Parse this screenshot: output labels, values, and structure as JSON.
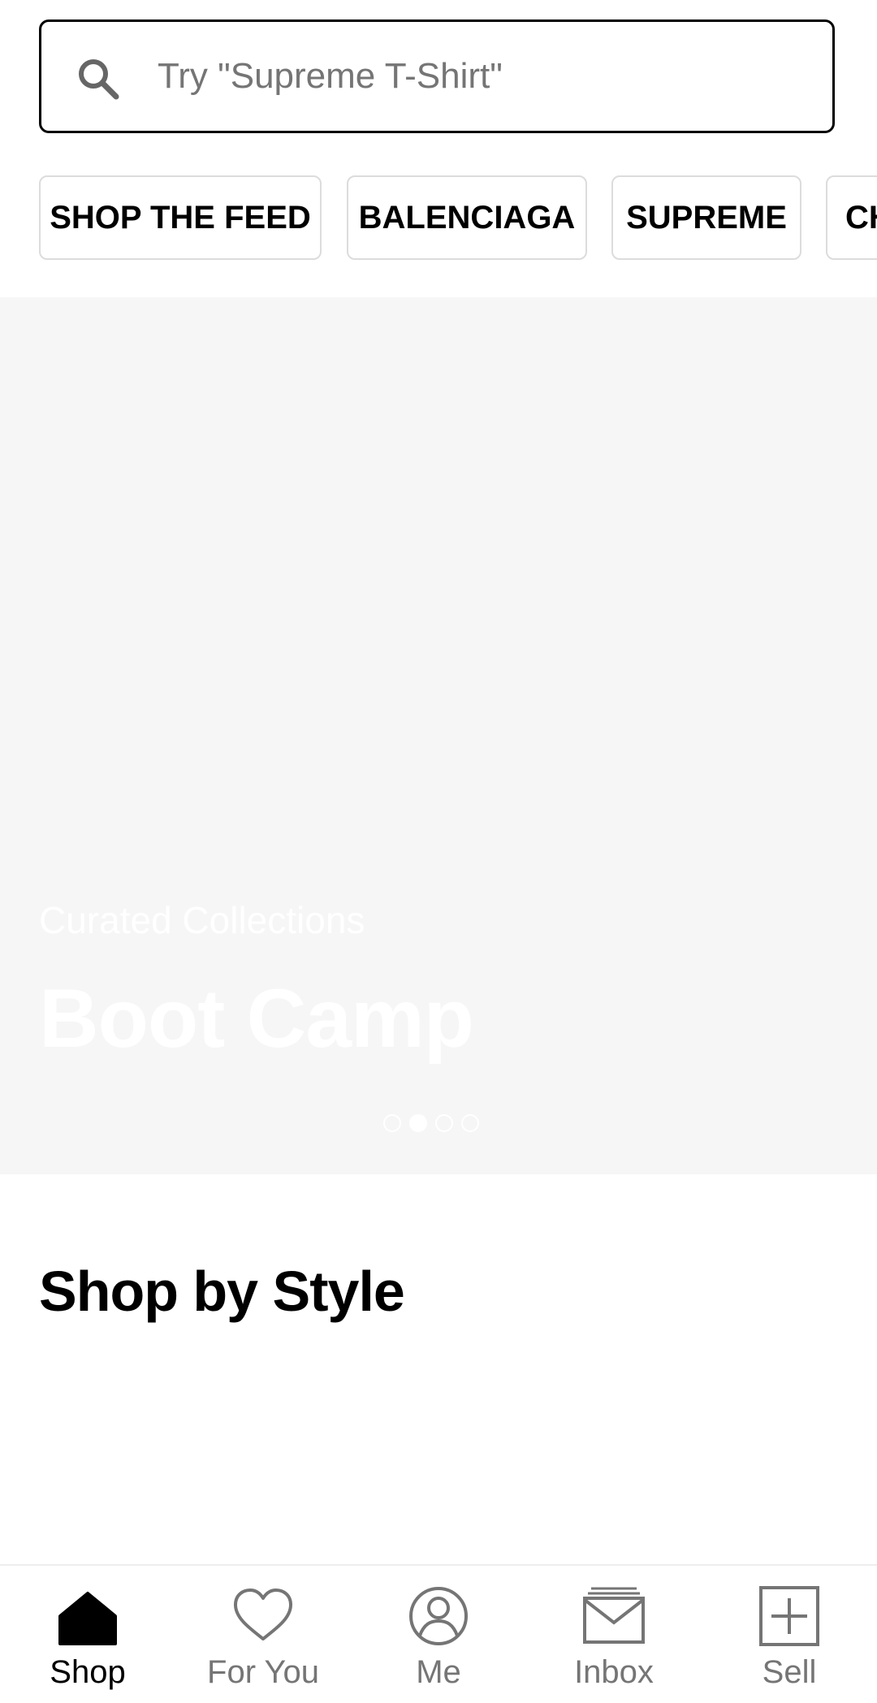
{
  "search": {
    "placeholder": "Try \"Supreme T-Shirt\"",
    "icon": "search-icon"
  },
  "chips": [
    {
      "label": "SHOP THE FEED"
    },
    {
      "label": "BALENCIAGA"
    },
    {
      "label": "SUPREME"
    },
    {
      "label": "CH"
    }
  ],
  "hero": {
    "subtitle": "Curated Collections",
    "title": "Boot Camp",
    "dots_total": 4,
    "dots_active_index": 1
  },
  "section": {
    "heading": "Shop by Style"
  },
  "bottom_nav": {
    "items": [
      {
        "label": "Shop",
        "icon": "home-icon",
        "active": true
      },
      {
        "label": "For You",
        "icon": "heart-icon",
        "active": false
      },
      {
        "label": "Me",
        "icon": "profile-icon",
        "active": false
      },
      {
        "label": "Inbox",
        "icon": "mail-icon",
        "active": false
      },
      {
        "label": "Sell",
        "icon": "plus-square-icon",
        "active": false
      }
    ]
  },
  "colors": {
    "placeholder_text": "#757575",
    "hero_background": "#f6f6f6",
    "inactive_nav": "#757575",
    "active_nav": "#000000"
  }
}
